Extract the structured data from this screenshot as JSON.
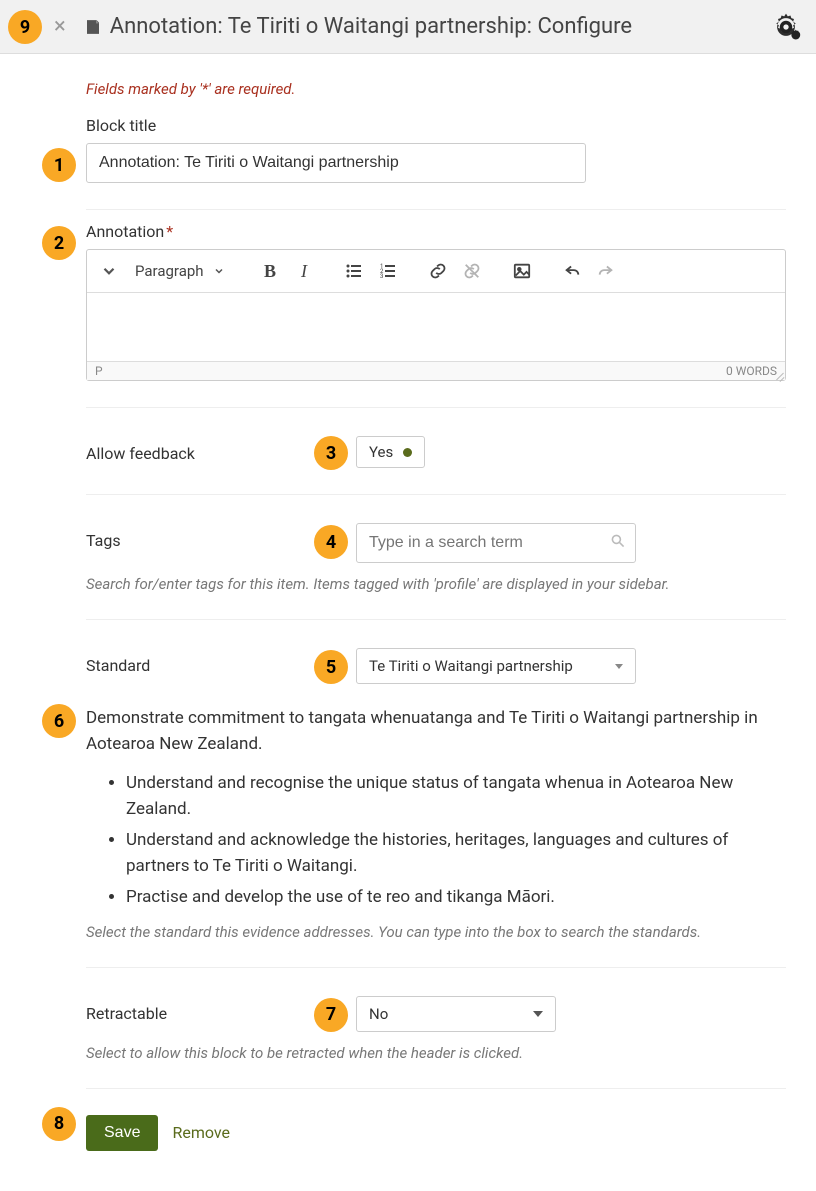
{
  "header": {
    "title": "Annotation: Te Tiriti o Waitangi partnership: Configure"
  },
  "required_note": "Fields marked by '*' are required.",
  "block_title": {
    "label": "Block title",
    "value": "Annotation: Te Tiriti o Waitangi partnership"
  },
  "annotation": {
    "label": "Annotation",
    "toolbar_paragraph": "Paragraph",
    "status_path": "P",
    "status_words": "0 WORDS"
  },
  "allow_feedback": {
    "label": "Allow feedback",
    "value": "Yes"
  },
  "tags": {
    "label": "Tags",
    "placeholder": "Type in a search term",
    "help": "Search for/enter tags for this item. Items tagged with 'profile' are displayed in your sidebar."
  },
  "standard": {
    "label": "Standard",
    "value": "Te Tiriti o Waitangi partnership",
    "description_intro": "Demonstrate commitment to tangata whenuatanga and Te Tiriti o Waitangi partnership in Aotearoa New Zealand.",
    "bullets": [
      "Understand and recognise the unique status of tangata whenua in Aotearoa New Zealand.",
      "Understand and acknowledge the histories, heritages, languages and cultures of partners to Te Tiriti o Waitangi.",
      "Practise and develop the use of te reo and tikanga Māori."
    ],
    "help": "Select the standard this evidence addresses. You can type into the box to search the standards."
  },
  "retractable": {
    "label": "Retractable",
    "value": "No",
    "help": "Select to allow this block to be retracted when the header is clicked."
  },
  "actions": {
    "save": "Save",
    "remove": "Remove"
  },
  "badges": [
    "1",
    "2",
    "3",
    "4",
    "5",
    "6",
    "7",
    "8",
    "9"
  ]
}
